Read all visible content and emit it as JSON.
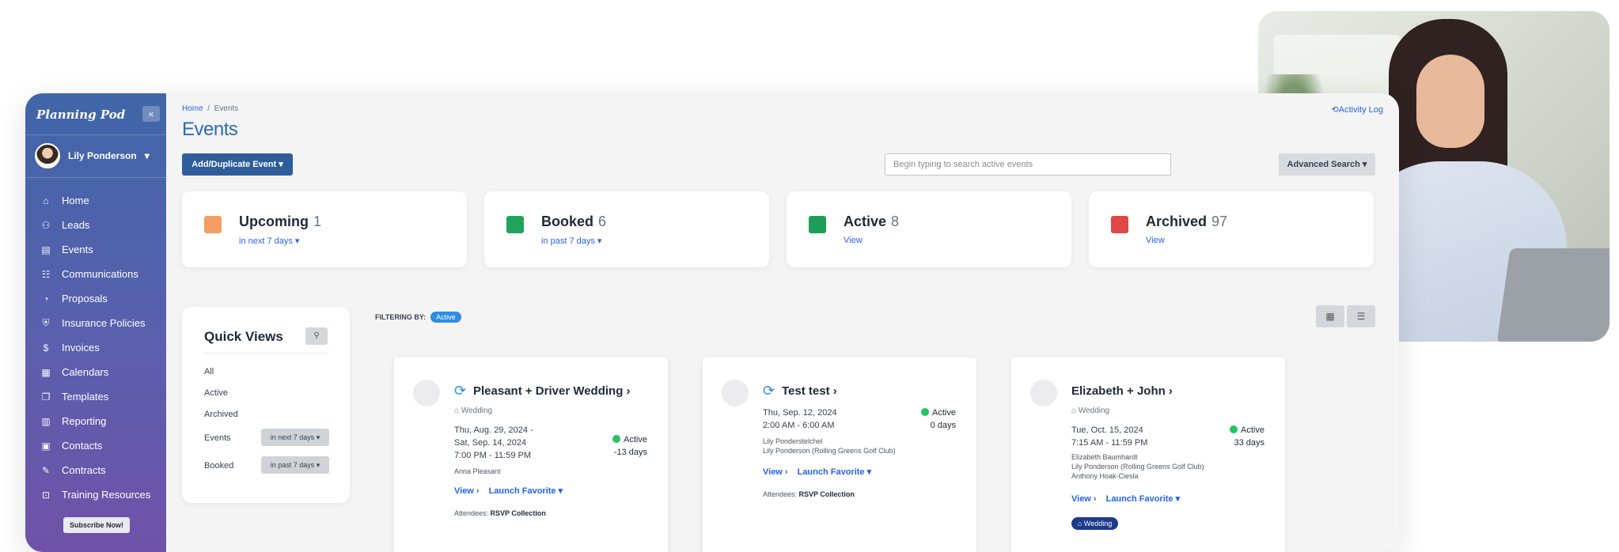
{
  "sidebar": {
    "brand": "Planning Pod",
    "collapse_icon": "«",
    "user_name": "Lily Ponderson",
    "items": [
      {
        "icon": "⌂",
        "label": "Home"
      },
      {
        "icon": "⚇",
        "label": "Leads"
      },
      {
        "icon": "▤",
        "label": "Events"
      },
      {
        "icon": "☷",
        "label": "Communications"
      },
      {
        "icon": "◔",
        "label": "Proposals"
      },
      {
        "icon": "⛨",
        "label": "Insurance Policies"
      },
      {
        "icon": "$",
        "label": "Invoices"
      },
      {
        "icon": "▦",
        "label": "Calendars"
      },
      {
        "icon": "❐",
        "label": "Templates"
      },
      {
        "icon": "▥",
        "label": "Reporting"
      },
      {
        "icon": "▣",
        "label": "Contacts"
      },
      {
        "icon": "✎",
        "label": "Contracts"
      },
      {
        "icon": "⊡",
        "label": "Training Resources"
      }
    ],
    "subscribe_label": "Subscribe Now!"
  },
  "header": {
    "breadcrumb_home": "Home",
    "breadcrumb_sep": "/",
    "breadcrumb_current": "Events",
    "activity_log": "⟲Activity Log",
    "title": "Events",
    "add_button": "Add/Duplicate Event ▾",
    "search_placeholder": "Begin typing to search active events",
    "advanced_search": "Advanced Search ▾"
  },
  "stats": [
    {
      "name": "Upcoming",
      "count": "1",
      "sub": "in next 7 days ▾",
      "color": "#f59e64"
    },
    {
      "name": "Booked",
      "count": "6",
      "sub": "in past 7 days ▾",
      "color": "#22a35a"
    },
    {
      "name": "Active",
      "count": "8",
      "sub": "View",
      "color": "#1e9e57"
    },
    {
      "name": "Archived",
      "count": "97",
      "sub": "View",
      "color": "#e04848"
    }
  ],
  "quick_views": {
    "title": "Quick Views",
    "search_icon": "⚲",
    "items": [
      "All",
      "Active",
      "Archived"
    ],
    "events_label": "Events",
    "events_pill": "in next 7 days ▾",
    "booked_label": "Booked",
    "booked_pill": "in past 7 days ▾"
  },
  "filter": {
    "label": "FILTERING BY:",
    "badge": "Active"
  },
  "view_toggle": {
    "grid_icon": "▦",
    "list_icon": "☰"
  },
  "cards": [
    {
      "title": "Pleasant + Driver Wedding ›",
      "tag": "⌂ Wedding",
      "dates": [
        "Thu, Aug. 29, 2024 -",
        "Sat, Sep. 14, 2024",
        "7:00 PM - 11:59 PM"
      ],
      "people": [
        "Anna Pleasant"
      ],
      "status": "Active",
      "days": "-13 days",
      "view": "View ›",
      "launch": "Launch Favorite ▾",
      "att_label": "Attendees:",
      "att_value": "RSVP Collection"
    },
    {
      "title": "Test test ›",
      "tag": "",
      "dates": [
        "Thu, Sep. 12, 2024",
        "2:00 AM - 6:00 AM"
      ],
      "people": [
        "Lily Ponderstelchel",
        "Lily Ponderson (Rolling Greens Golf Club)"
      ],
      "status": "Active",
      "days": "0 days",
      "view": "View ›",
      "launch": "Launch Favorite ▾",
      "att_label": "Attendees:",
      "att_value": "RSVP Collection"
    },
    {
      "title": "Elizabeth + John ›",
      "tag": "⌂ Wedding",
      "dates": [
        "Tue, Oct. 15, 2024",
        "7:15 AM - 11:59 PM"
      ],
      "people": [
        "Elizabeth Baumhardt",
        "Lily Ponderson (Rolling Greens Golf Club)",
        "Anthony Hoak-Ciesla"
      ],
      "status": "Active",
      "days": "33 days",
      "view": "View ›",
      "launch": "Launch Favorite ▾",
      "wedding_tag": "⌂ Wedding"
    }
  ]
}
